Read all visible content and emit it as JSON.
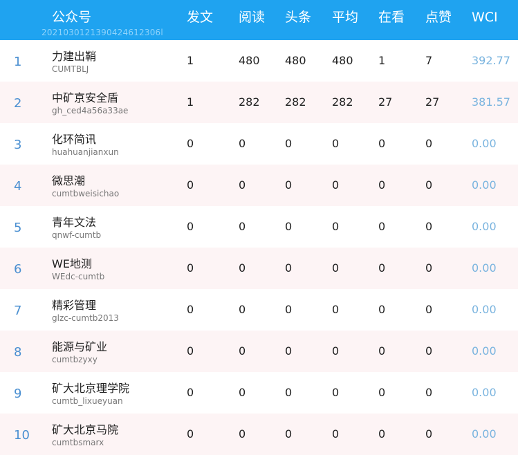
{
  "header": {
    "account": "公众号",
    "posts": "发文",
    "reads": "阅读",
    "top": "头条",
    "avg": "平均",
    "looking": "在看",
    "likes": "点赞",
    "wci": "WCI",
    "subtitle": "2021030121390424612306l"
  },
  "rows": [
    {
      "rank": "1",
      "name": "力建出鞘",
      "account": "CUMTBLJ",
      "posts": "1",
      "reads": "480",
      "top": "480",
      "avg": "480",
      "looking": "1",
      "likes": "7",
      "wci": "392.77"
    },
    {
      "rank": "2",
      "name": "中矿京安全盾",
      "account": "gh_ced4a56a33ae",
      "posts": "1",
      "reads": "282",
      "top": "282",
      "avg": "282",
      "looking": "27",
      "likes": "27",
      "wci": "381.57"
    },
    {
      "rank": "3",
      "name": "化环简讯",
      "account": "huahuanjianxun",
      "posts": "0",
      "reads": "0",
      "top": "0",
      "avg": "0",
      "looking": "0",
      "likes": "0",
      "wci": "0.00"
    },
    {
      "rank": "4",
      "name": "微思潮",
      "account": "cumtbweisichao",
      "posts": "0",
      "reads": "0",
      "top": "0",
      "avg": "0",
      "looking": "0",
      "likes": "0",
      "wci": "0.00"
    },
    {
      "rank": "5",
      "name": "青年文法",
      "account": "qnwf-cumtb",
      "posts": "0",
      "reads": "0",
      "top": "0",
      "avg": "0",
      "looking": "0",
      "likes": "0",
      "wci": "0.00"
    },
    {
      "rank": "6",
      "name": "WE地测",
      "account": "WEdc-cumtb",
      "posts": "0",
      "reads": "0",
      "top": "0",
      "avg": "0",
      "looking": "0",
      "likes": "0",
      "wci": "0.00"
    },
    {
      "rank": "7",
      "name": "精彩管理",
      "account": "glzc-cumtb2013",
      "posts": "0",
      "reads": "0",
      "top": "0",
      "avg": "0",
      "looking": "0",
      "likes": "0",
      "wci": "0.00"
    },
    {
      "rank": "8",
      "name": "能源与矿业",
      "account": "cumtbzyxy",
      "posts": "0",
      "reads": "0",
      "top": "0",
      "avg": "0",
      "looking": "0",
      "likes": "0",
      "wci": "0.00"
    },
    {
      "rank": "9",
      "name": "矿大北京理学院",
      "account": "cumtb_lixueyuan",
      "posts": "0",
      "reads": "0",
      "top": "0",
      "avg": "0",
      "looking": "0",
      "likes": "0",
      "wci": "0.00"
    },
    {
      "rank": "10",
      "name": "矿大北京马院",
      "account": "cumtbsmarx",
      "posts": "0",
      "reads": "0",
      "top": "0",
      "avg": "0",
      "looking": "0",
      "likes": "0",
      "wci": "0.00"
    }
  ]
}
